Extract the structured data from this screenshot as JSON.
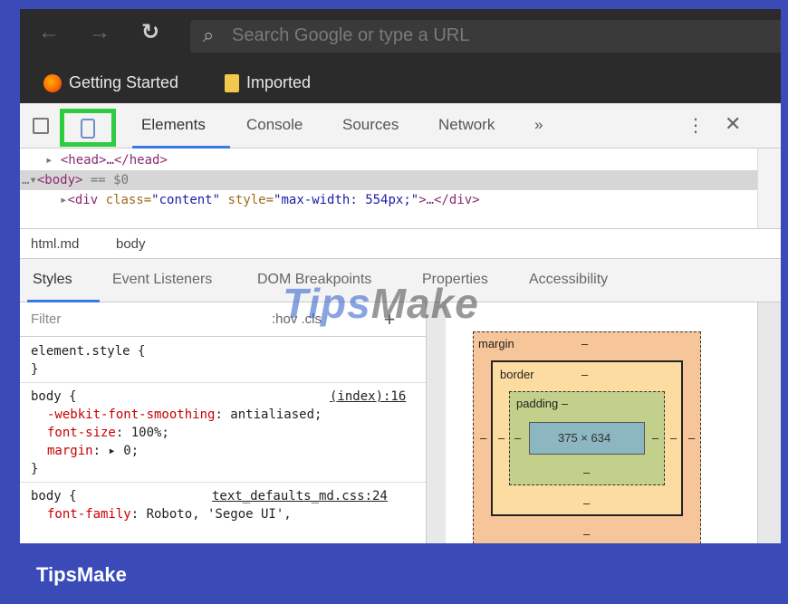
{
  "browser": {
    "omnibox_placeholder": "Search Google or type a URL",
    "bookmarks": [
      "Getting Started",
      "Imported"
    ]
  },
  "devtools": {
    "tabs": [
      "Elements",
      "Console",
      "Sources",
      "Network",
      "»"
    ],
    "more_label": "⋮",
    "close_label": "✕",
    "dom": {
      "head_line": "<head>…</head>",
      "body_line": "<body>",
      "body_suffix": " == $0",
      "div_open": "<div ",
      "div_attr": "class=",
      "div_class": "\"content\"",
      "div_attr2": " style=",
      "div_style": "\"max-width: 554px;\"",
      "div_close": ">…</div>"
    },
    "breadcrumb": [
      "html.md",
      "body"
    ],
    "subtabs": [
      "Styles",
      "Event Listeners",
      "DOM Breakpoints",
      "Properties",
      "Accessibility"
    ],
    "filter_placeholder": "Filter",
    "filter_hov": ":hov .cls",
    "filter_add": "+",
    "styles": {
      "rule1_selector": "element.style {",
      "rule1_close": "}",
      "rule2_selector": "body {",
      "rule2_source": "(index):16",
      "rule2_props": [
        {
          "name": "-webkit-font-smoothing",
          "value": ": antialiased;"
        },
        {
          "name": "font-size",
          "value": ": 100%;"
        },
        {
          "name": "margin",
          "value": ": ▸ 0;"
        }
      ],
      "rule2_close": "}",
      "rule3_selector": "body {",
      "rule3_source": "text_defaults_md.css:24",
      "rule3_prop_name": "font-family",
      "rule3_prop_value": ": Roboto, 'Segoe UI',"
    },
    "box_model": {
      "margin_label": "margin",
      "margin_value": "–",
      "border_label": "border",
      "border_value": "–",
      "padding_label": "padding –",
      "content_size": "375 × 634",
      "side_dash": "–",
      "padding_bottom": "–",
      "border_bottom": "–",
      "margin_bottom": "–"
    }
  },
  "watermark": {
    "part1": "Tips",
    "part2": "Make"
  },
  "footer": {
    "brand": "TipsMake"
  }
}
